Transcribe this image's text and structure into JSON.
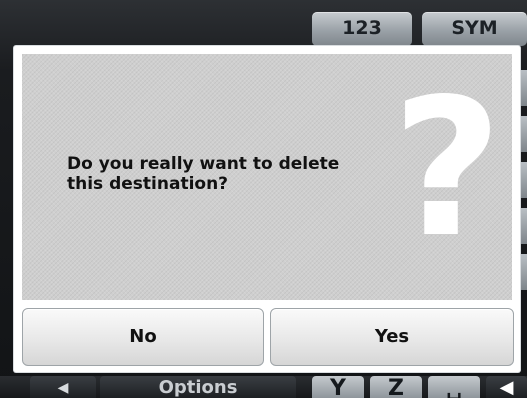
{
  "keyboard": {
    "top_keys": [
      "123",
      "SYM"
    ],
    "bottom_keys": {
      "back": "◀",
      "options": "Options",
      "y": "Y",
      "z": "Z",
      "space": "␣",
      "delete": "◀"
    }
  },
  "dialog": {
    "message": "Do you really want to delete\nthis destination?",
    "icon": "question-mark-icon",
    "icon_glyph": "?",
    "buttons": {
      "no": "No",
      "yes": "Yes"
    }
  },
  "colors": {
    "dialog_background": "#cfcfcf",
    "frame": "#ffffff",
    "text": "#111111"
  }
}
